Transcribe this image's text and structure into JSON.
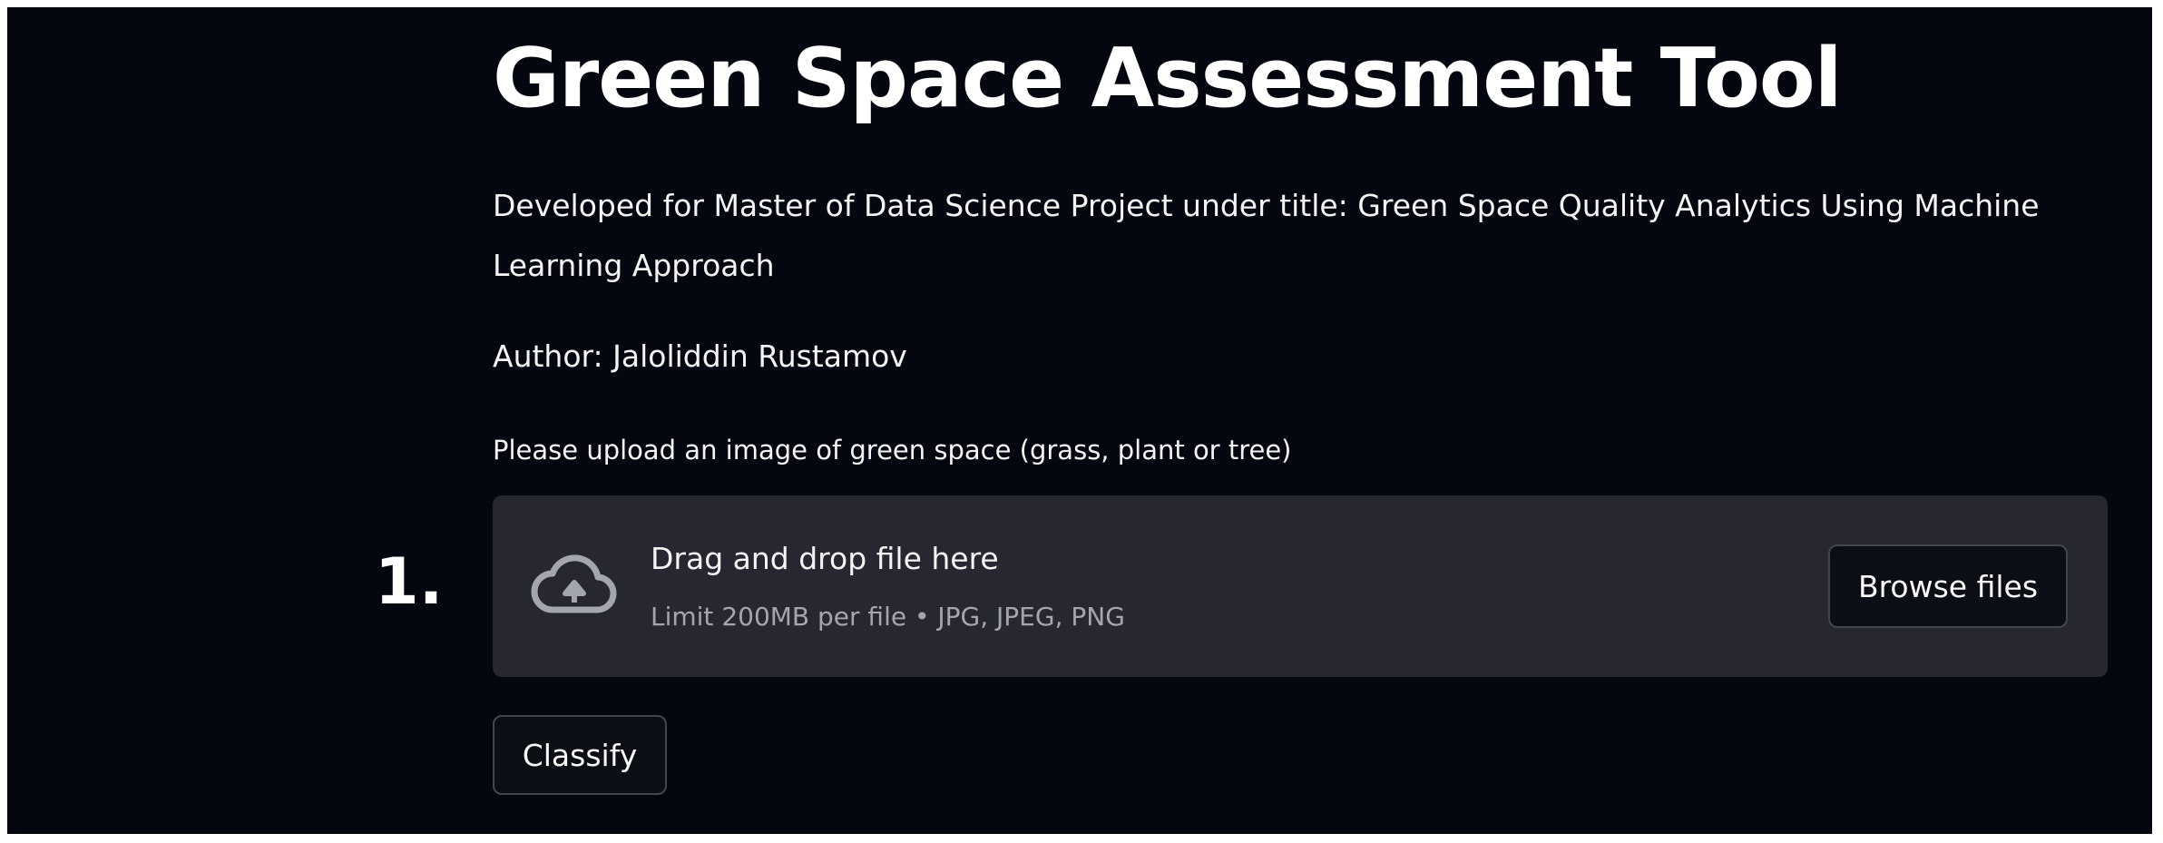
{
  "page": {
    "title": "Green Space Assessment Tool",
    "description": "Developed for Master of Data Science Project under title: Green Space Quality Analytics Using Machine Learning Approach",
    "author": "Author: Jaloliddin Rustamov"
  },
  "uploader": {
    "label": "Please upload an image of green space (grass, plant or tree)",
    "step_number": "1.",
    "icon": "cloud-upload-icon",
    "drop_title": "Drag and drop file here",
    "drop_limit": "Limit 200MB per file • JPG, JPEG, PNG",
    "browse_label": "Browse files"
  },
  "actions": {
    "classify_label": "Classify"
  },
  "colors": {
    "background": "#04070f",
    "dropzone": "#262731",
    "button_bg": "#0c0e16",
    "button_border": "#44464f",
    "text": "#fafafa",
    "muted_text": "#a3a6ae"
  }
}
